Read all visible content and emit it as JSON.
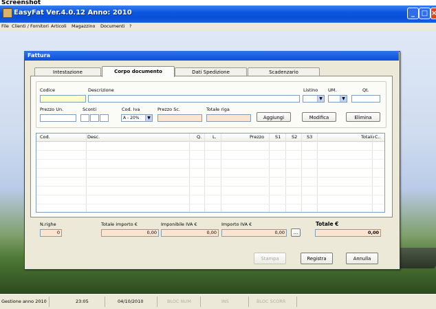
{
  "page_header": "Screenshot",
  "window": {
    "title": "EasyFat Ver.4.0.12 Anno: 2010",
    "min": "_",
    "max": "□",
    "close": "×"
  },
  "menu": [
    "File",
    "Clienti / Fornitori",
    "Articoli",
    "Magazzino",
    "Documenti",
    "?"
  ],
  "dialog": {
    "title": "Fattura",
    "tabs": [
      "Intestazione",
      "Corpo documento",
      "Dati Spedizione",
      "Scadenzario"
    ],
    "active_tab": "Corpo documento",
    "labels": {
      "codice": "Codice",
      "descrizione": "Descrizione",
      "listino": "Listino",
      "um": "UM.",
      "qt": "Qt.",
      "prezzo_un": "Prezzo Un.",
      "sconti": "Sconti",
      "cod_iva": "Cod. Iva",
      "prezzo_sc": "Prezzo Sc.",
      "totale_riga": "Totale riga"
    },
    "cod_iva_value": "A - 20%",
    "buttons": {
      "aggiungi": "Aggiungi",
      "modifica": "Modifica",
      "elimina": "Elimina"
    },
    "grid_columns": [
      "Cod.",
      "Desc.",
      "Q.",
      "L.",
      "Prezzo",
      "S1",
      "S2",
      "S3",
      "Totale",
      "C.."
    ],
    "totals": {
      "n_righe_label": "N.righe",
      "n_righe": "0",
      "totale_importo_label": "Totale importo €",
      "totale_importo": "0,00",
      "imponibile_label": "Imponibile IVA €",
      "imponibile": "0,00",
      "importo_iva_label": "Importo IVA €",
      "importo_iva": "0,00",
      "ellipsis": "...",
      "totale_label": "Totale €",
      "totale": "0,00"
    },
    "footer_buttons": {
      "stampa": "Stampa",
      "registra": "Registra",
      "annulla": "Annulla"
    }
  },
  "status_bar": {
    "gestione": "Gestione anno 2010",
    "time": "23:05",
    "date": "04/10/2010",
    "bloc_num": "BLOC NUM",
    "ins": "INS",
    "bloc_scorr": "BLOC SCORR"
  }
}
